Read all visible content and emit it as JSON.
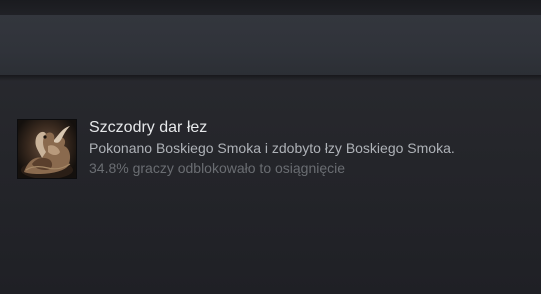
{
  "achievement": {
    "title": "Szczodry dar łez",
    "description": "Pokonano Boskiego Smoka i zdobyto łzy Boskiego Smoka.",
    "unlock_stat": "34.8% graczy odblokowało to osiągnięcie",
    "icon": "dragon-achievement-icon"
  },
  "colors": {
    "title": "#e6e8ea",
    "description": "#aeb2b7",
    "stat": "#6a6d72",
    "header": "#31343b",
    "background": "#26272c"
  }
}
